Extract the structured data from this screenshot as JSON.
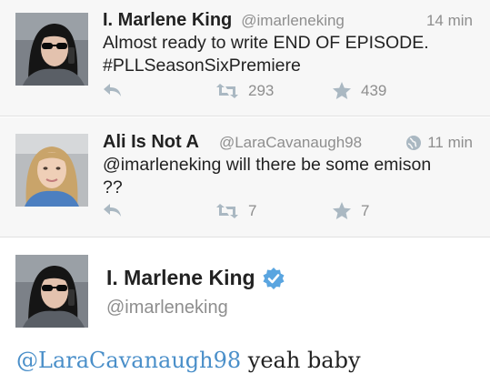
{
  "tweets": [
    {
      "name": "I. Marlene King",
      "handle": "@imarleneking",
      "time": "14 min",
      "text_line1": "Almost ready to write END OF EPISODE.",
      "text_line2": "#PLLSeasonSixPremiere",
      "retweets": "293",
      "favorites": "439",
      "icons": [
        "reply-icon",
        "retweet-icon",
        "star-icon"
      ]
    },
    {
      "name": "Ali Is Not A",
      "handle": "@LaraCavanaugh98",
      "time": "11 min",
      "text_line1": "@imarleneking will there be some emison",
      "text_line2": "??",
      "retweets": "7",
      "favorites": "7",
      "icons": [
        "globe-icon",
        "reply-icon",
        "retweet-icon",
        "star-icon"
      ]
    }
  ],
  "focus": {
    "name": "I. Marlene King",
    "handle": "@imarleneking",
    "mention": "@LaraCavanaugh98",
    "text": " yeah baby",
    "verified_color": "#5aa5e0",
    "icons": [
      "verified-badge-icon"
    ]
  },
  "colors": {
    "accent": "#4a8fc9",
    "muted": "#8e8e8e",
    "icon": "#aab8c2"
  }
}
